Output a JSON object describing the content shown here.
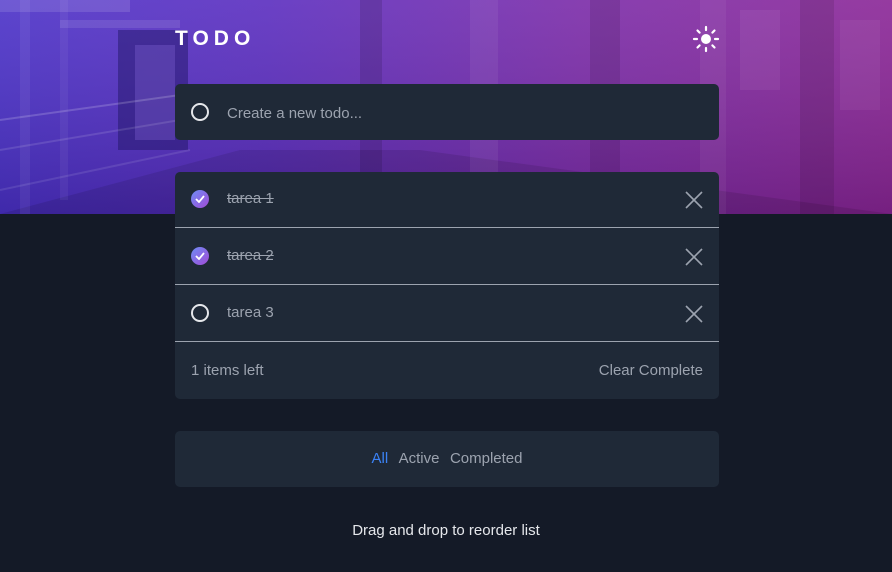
{
  "header": {
    "title": "TODO",
    "theme_icon": "sun-icon"
  },
  "new_todo": {
    "placeholder": "Create a new todo...",
    "value": ""
  },
  "todos": [
    {
      "text": "tarea 1",
      "completed": true
    },
    {
      "text": "tarea 2",
      "completed": true
    },
    {
      "text": "tarea 3",
      "completed": false
    }
  ],
  "footer": {
    "items_left": "1 items left",
    "clear_label": "Clear Complete"
  },
  "filters": {
    "all": "All",
    "active": "Active",
    "completed": "Completed",
    "selected": "All"
  },
  "hint": "Drag and drop to reorder list",
  "colors": {
    "accent": "#3b82f6",
    "check_gradient_start": "#6e8cf5",
    "check_gradient_end": "#a24bd6",
    "card": "#1f2937",
    "background": "#141a27"
  }
}
